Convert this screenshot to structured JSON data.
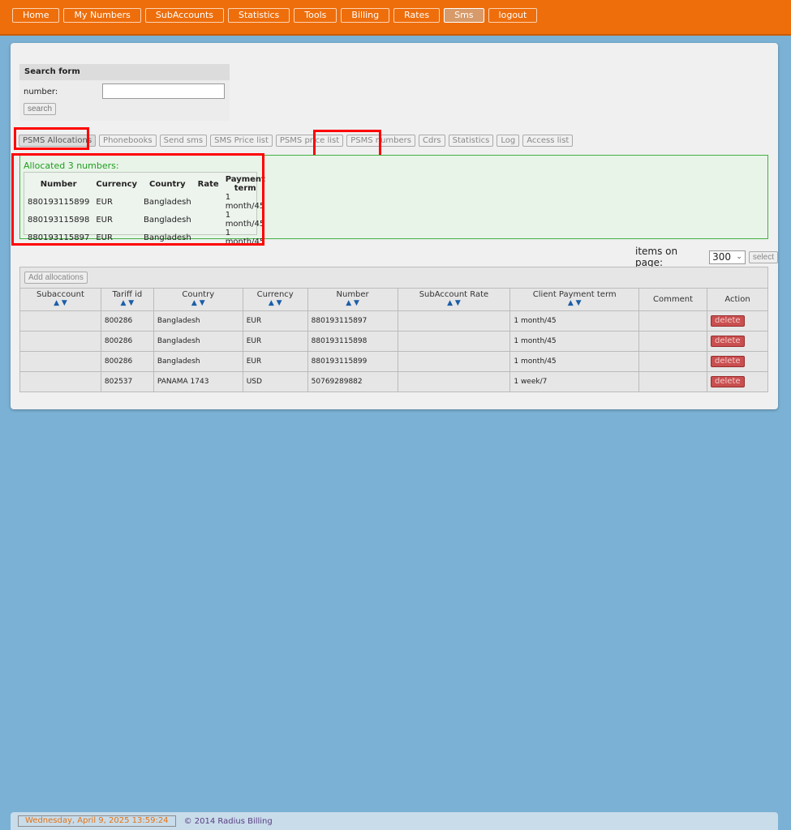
{
  "nav": [
    "Home",
    "My Numbers",
    "SubAccounts",
    "Statistics",
    "Tools",
    "Billing",
    "Rates",
    "Sms",
    "logout"
  ],
  "nav_active": "Sms",
  "search": {
    "title": "Search form",
    "label": "number:",
    "value": "",
    "button": "search"
  },
  "tabs": [
    "PSMS Allocations",
    "Phonebooks",
    "Send sms",
    "SMS Price list",
    "PSMS price list",
    "PSMS numbers",
    "Cdrs",
    "Statistics",
    "Log",
    "Access list"
  ],
  "tab_active": "PSMS Allocations",
  "allocated": {
    "title": "Allocated 3 numbers:",
    "headers": [
      "Number",
      "Currency",
      "Country",
      "Rate",
      "Payment term"
    ],
    "rows": [
      [
        "880193115899",
        "EUR",
        "Bangladesh",
        "",
        "1 month/45"
      ],
      [
        "880193115898",
        "EUR",
        "Bangladesh",
        "",
        "1 month/45"
      ],
      [
        "880193115897",
        "EUR",
        "Bangladesh",
        "",
        "1 month/45"
      ]
    ]
  },
  "pager": {
    "label": "items on page:",
    "value": "300",
    "button": "select"
  },
  "add_button": "Add allocations",
  "table": {
    "headers": [
      "Subaccount",
      "Tariff id",
      "Country",
      "Currency",
      "Number",
      "SubAccount Rate",
      "Client Payment term",
      "Comment",
      "Action"
    ],
    "sortable": [
      true,
      true,
      true,
      true,
      true,
      true,
      true,
      false,
      false
    ],
    "sort_glyph": "▲ ▼",
    "rows": [
      [
        "",
        "800286",
        "Bangladesh",
        "EUR",
        "880193115897",
        "",
        "1 month/45",
        "",
        "delete"
      ],
      [
        "",
        "800286",
        "Bangladesh",
        "EUR",
        "880193115898",
        "",
        "1 month/45",
        "",
        "delete"
      ],
      [
        "",
        "800286",
        "Bangladesh",
        "EUR",
        "880193115899",
        "",
        "1 month/45",
        "",
        "delete"
      ],
      [
        "",
        "802537",
        "PANAMA 1743",
        "USD",
        "50769289882",
        "",
        "1 week/7",
        "",
        "delete"
      ]
    ]
  },
  "footer": {
    "date": "Wednesday, April 9, 2025   13:59:24",
    "copyright": "© 2014 Radius Billing"
  },
  "colors": {
    "topbar": "#ee6e0c",
    "background": "#7ab1d4",
    "highlight": "#ff0000",
    "alloc_text": "#1f9e1f",
    "delete": "#c94f50",
    "sort_arrow": "#1a5ea8"
  }
}
